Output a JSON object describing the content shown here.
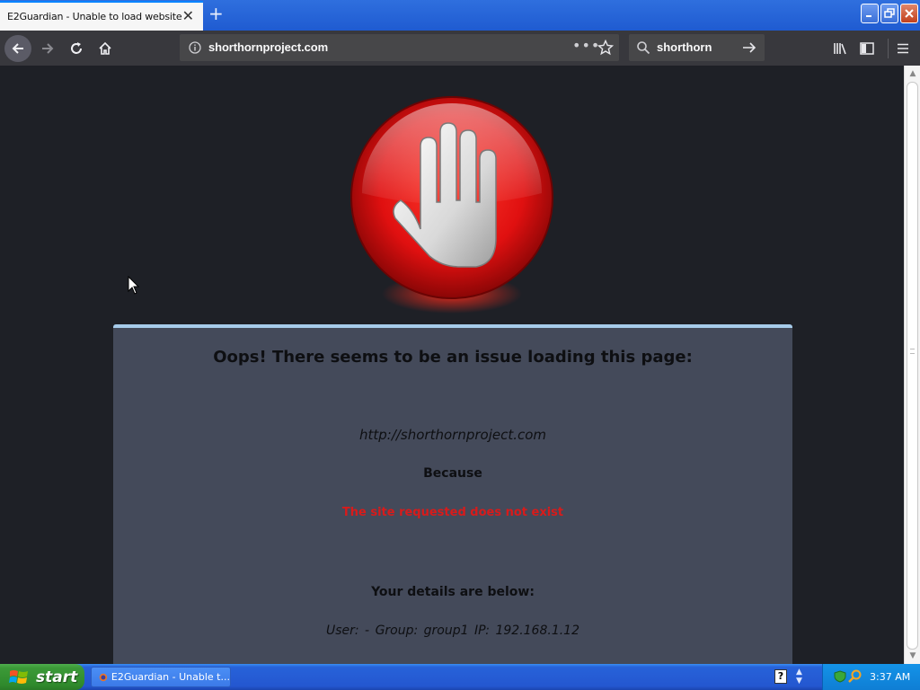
{
  "browser": {
    "tab_title": "E2Guardian - Unable to load website",
    "tab_close": "✕",
    "new_tab": "+",
    "url": "shorthornproject.com",
    "url_more": "•••",
    "search_query": "shorthorn"
  },
  "page": {
    "heading": "Oops! There seems to be an issue loading this page:",
    "requested_url": "http://shorthornproject.com",
    "because_label": "Because",
    "reason": "The site requested does not exist",
    "details_heading": "Your details are below:",
    "details": "User: -   Group: group1   IP: 192.168.1.12"
  },
  "taskbar": {
    "start_label": "start",
    "task_item": "E2Guardian - Unable t...",
    "help_icon": "?",
    "clock": "3:37 AM"
  },
  "colors": {
    "reason_red": "#d81b1b",
    "panel_bg": "#444a5a",
    "panel_border": "#a6cbea"
  }
}
